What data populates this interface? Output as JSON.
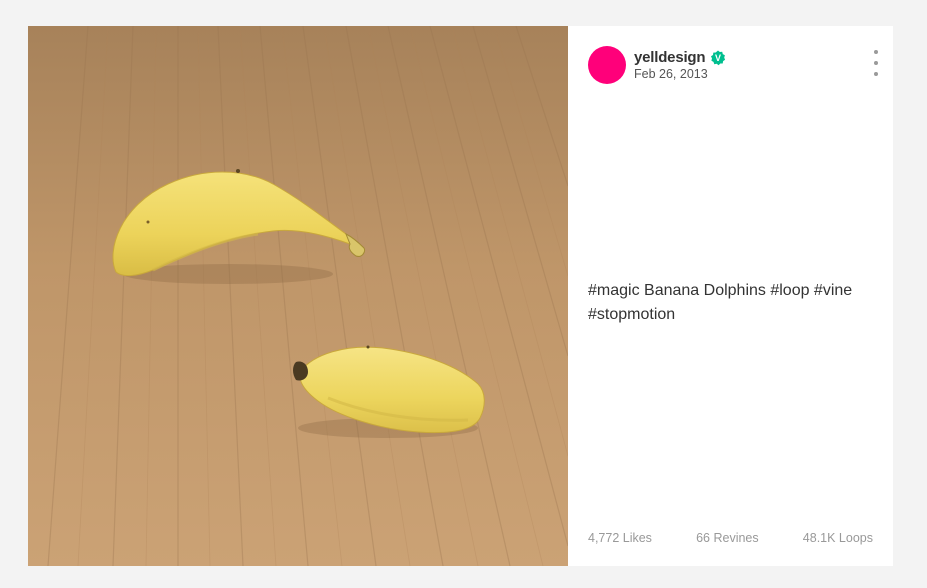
{
  "post": {
    "username": "yelldesign",
    "date": "Feb 26, 2013",
    "description": "#magic Banana Dolphins #loop #vine #stopmotion",
    "avatar_color": "#ff007a",
    "verified_color": "#00bf8f",
    "more_icon": "vertical-ellipsis-icon"
  },
  "stats": {
    "likes": "4,772 Likes",
    "revines": "66 Revines",
    "loops": "48.1K Loops"
  },
  "media": {
    "subject": "two banana pieces on a wooden table",
    "wood_color": "#c39a6b",
    "banana_color": "#f0d860"
  }
}
